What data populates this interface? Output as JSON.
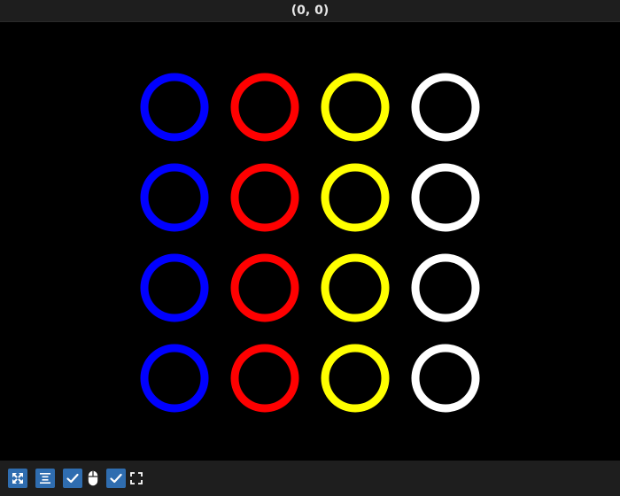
{
  "window": {
    "title": "(0, 0)"
  },
  "canvas": {
    "background": "#000000",
    "rings": {
      "rows": 4,
      "columns": [
        {
          "color_name": "blue",
          "color": "#0000ff"
        },
        {
          "color_name": "red",
          "color": "#ff0000"
        },
        {
          "color_name": "yellow",
          "color": "#ffff00"
        },
        {
          "color_name": "white",
          "color": "#ffffff"
        }
      ]
    }
  },
  "toolbar": {
    "accent": "#2f6db0",
    "items": [
      {
        "icon": "fit-view-icon",
        "kind": "button"
      },
      {
        "icon": "align-center-icon",
        "kind": "button"
      },
      {
        "icon": "checkbox-checked-icon",
        "kind": "checkbox",
        "checked": true
      },
      {
        "icon": "mouse-icon",
        "kind": "indicator"
      },
      {
        "icon": "checkbox-checked-icon",
        "kind": "checkbox",
        "checked": true
      },
      {
        "icon": "fullscreen-icon",
        "kind": "indicator"
      }
    ]
  }
}
